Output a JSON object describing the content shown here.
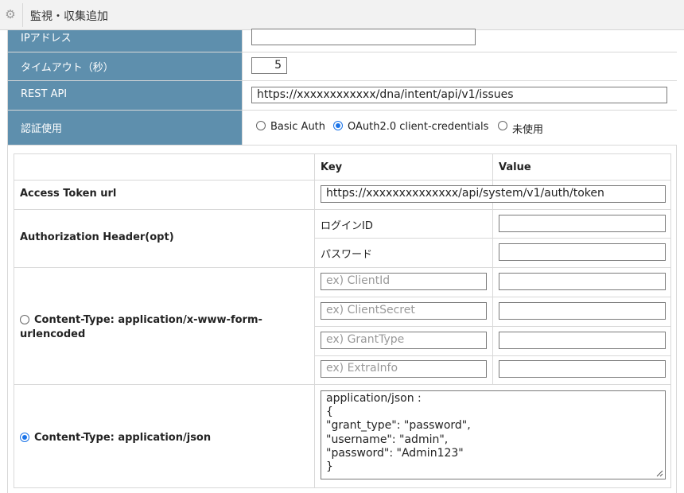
{
  "window": {
    "title": "監視・収集追加",
    "icon": "gear-icon"
  },
  "form": {
    "ip_label": "IPアドレス",
    "ip_value": "",
    "timeout_label": "タイムアウト（秒）",
    "timeout_value": "5",
    "rest_label": "REST API",
    "rest_value": "https://xxxxxxxxxxxx/dna/intent/api/v1/issues",
    "auth_label": "認証使用",
    "auth_options": [
      {
        "label": "Basic Auth",
        "selected": false
      },
      {
        "label": "OAuth2.0 client-credentials",
        "selected": true
      },
      {
        "label": "未使用",
        "selected": false
      }
    ]
  },
  "oauth_table": {
    "col_key": "Key",
    "col_value": "Value",
    "access_token_label": "Access Token url",
    "access_token_value": "https://xxxxxxxxxxxxxx/api/system/v1/auth/token",
    "auth_header_label": "Authorization Header(opt)",
    "auth_header_keys": [
      "ログインID",
      "パスワード"
    ],
    "auth_header_values": [
      "",
      ""
    ],
    "form_urlencoded_label": "Content-Type: application/x-www-form-urlencoded",
    "form_urlencoded_selected": false,
    "form_keys_placeholders": [
      "ex) ClientId",
      "ex) ClientSecret",
      "ex) GrantType",
      "ex) ExtraInfo"
    ],
    "form_values": [
      "",
      "",
      "",
      ""
    ],
    "json_label": "Content-Type: application/json",
    "json_selected": true,
    "json_body": "application/json :\n{\n\"grant_type\": \"password\",\n\"username\": \"admin\",\n\"password\": \"Admin123\"\n}"
  },
  "colors": {
    "label_bg": "#5e8fad",
    "radio_accent": "#1a73e8",
    "border": "#d8d8d8"
  }
}
